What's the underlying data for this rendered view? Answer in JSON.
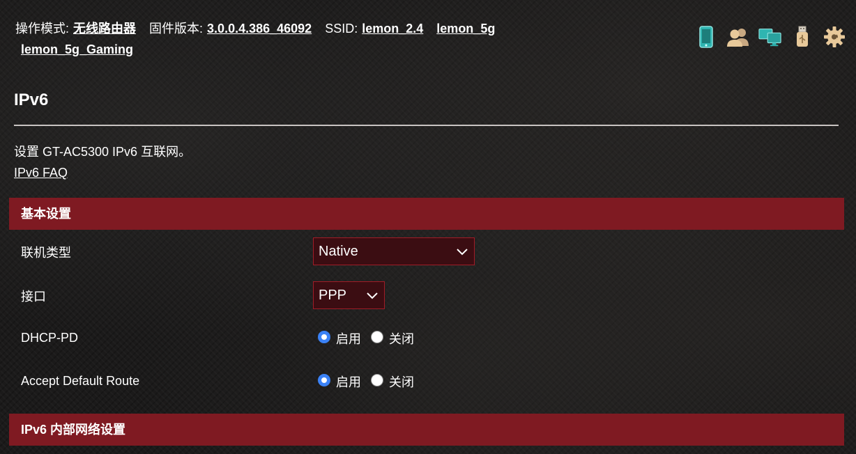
{
  "status_bar": {
    "mode_label": "操作模式:",
    "mode_value": "无线路由器",
    "firmware_label": "固件版本:",
    "firmware_value": "3.0.0.4.386_46092",
    "ssid_label": "SSID:",
    "ssids": [
      "lemon_2.4",
      "lemon_5g",
      "lemon_5g_Gaming"
    ]
  },
  "top_icons": [
    "mobile-app-icon",
    "users-icon",
    "network-monitors-icon",
    "usb-icon",
    "settings-gear-icon"
  ],
  "page": {
    "title": "IPv6",
    "description": "设置 GT-AC5300 IPv6 互联网。",
    "faq_link": "IPv6 FAQ"
  },
  "basic_section": {
    "header": "基本设置",
    "connection_type": {
      "label": "联机类型",
      "value": "Native"
    },
    "interface": {
      "label": "接口",
      "value": "PPP"
    },
    "dhcp_pd": {
      "label": "DHCP-PD",
      "options": [
        "启用",
        "关闭"
      ],
      "selected": "启用"
    },
    "accept_default_route": {
      "label": "Accept Default Route",
      "options": [
        "启用",
        "关闭"
      ],
      "selected": "启用"
    }
  },
  "lan_section": {
    "header": "IPv6 内部网络设置"
  },
  "colors": {
    "section_header_bg": "#7f1a22",
    "select_bg": "#3b0d12",
    "select_border": "#a11c27",
    "radio_accent": "#3b82f6",
    "icon_teal": "#2fb5b1",
    "icon_beige": "#e8c99a"
  }
}
